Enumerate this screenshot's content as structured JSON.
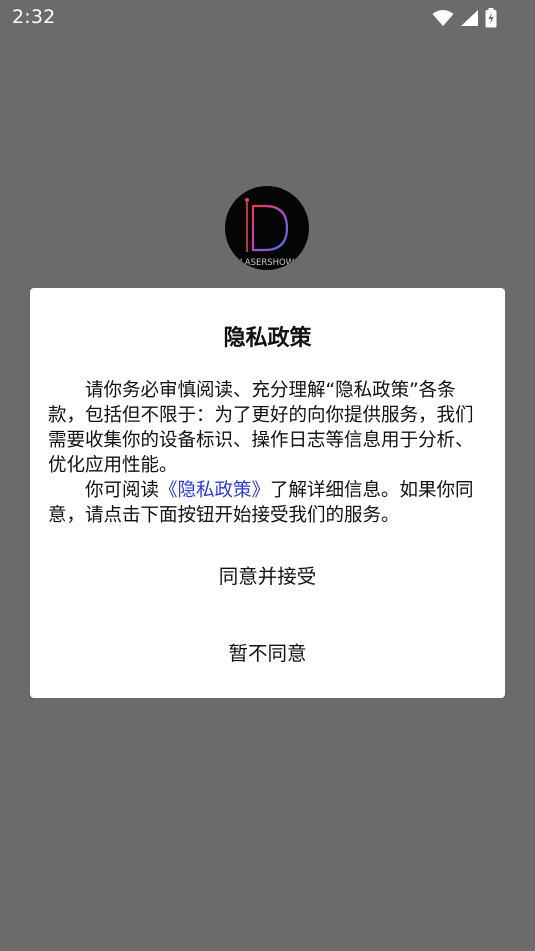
{
  "status_bar": {
    "time": "2:32",
    "icons": [
      "wifi-icon",
      "cellular-signal-icon",
      "battery-charging-icon"
    ]
  },
  "logo": {
    "text": "LASERSHOW"
  },
  "dialog": {
    "title": "隐私政策",
    "paragraph1": "请你务必审慎阅读、充分理解“隐私政策”各条款，包括但不限于：为了更好的向你提供服务，我们需要收集你的设备标识、操作日志等信息用于分析、优化应用性能。",
    "paragraph2_prefix": "你可阅读",
    "paragraph2_link": "《隐私政策》",
    "paragraph2_suffix": "了解详细信息。如果你同意，请点击下面按钮开始接受我们的服务。",
    "accept_label": "同意并接受",
    "decline_label": "暂不同意"
  },
  "colors": {
    "overlay": "#6b6b6b",
    "dialog_bg": "#ffffff",
    "link": "#2d3bd6"
  }
}
